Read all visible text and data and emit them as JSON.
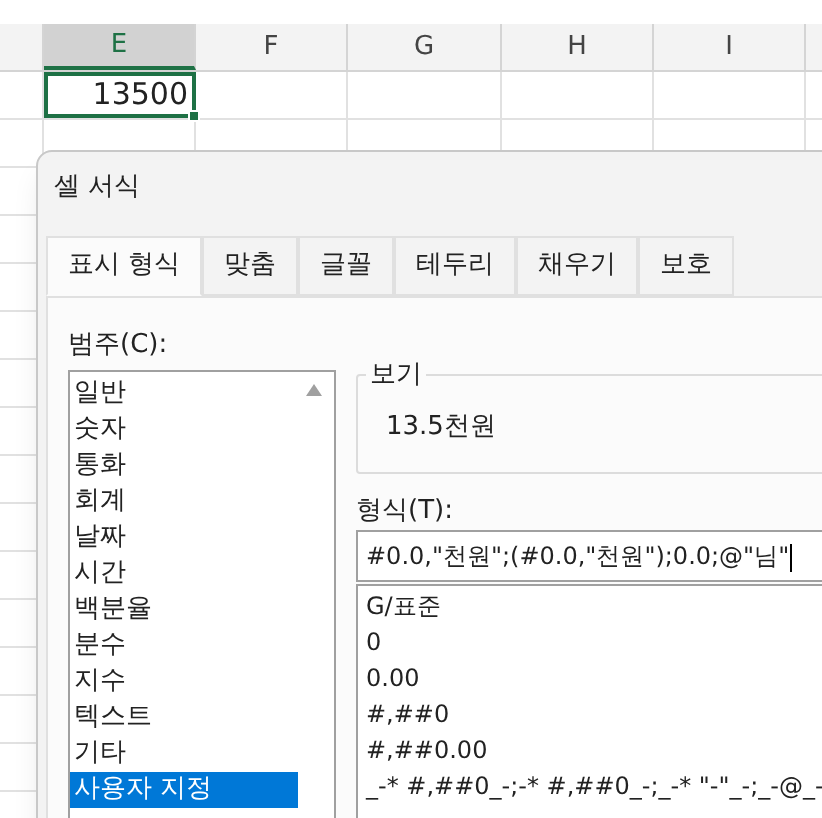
{
  "spreadsheet": {
    "columns": [
      {
        "label": "E",
        "selected": true
      },
      {
        "label": "F",
        "selected": false
      },
      {
        "label": "G",
        "selected": false
      },
      {
        "label": "H",
        "selected": false
      },
      {
        "label": "I",
        "selected": false
      }
    ],
    "cell_value": "13500"
  },
  "dialog": {
    "title": "셀 서식",
    "tabs": [
      {
        "label": "표시 형식",
        "selected": true
      },
      {
        "label": "맞춤",
        "selected": false
      },
      {
        "label": "글꼴",
        "selected": false
      },
      {
        "label": "테두리",
        "selected": false
      },
      {
        "label": "채우기",
        "selected": false
      },
      {
        "label": "보호",
        "selected": false
      }
    ],
    "category_label": "범주(C):",
    "categories": [
      {
        "label": "일반",
        "selected": false
      },
      {
        "label": "숫자",
        "selected": false
      },
      {
        "label": "통화",
        "selected": false
      },
      {
        "label": "회계",
        "selected": false
      },
      {
        "label": "날짜",
        "selected": false
      },
      {
        "label": "시간",
        "selected": false
      },
      {
        "label": "백분율",
        "selected": false
      },
      {
        "label": "분수",
        "selected": false
      },
      {
        "label": "지수",
        "selected": false
      },
      {
        "label": "텍스트",
        "selected": false
      },
      {
        "label": "기타",
        "selected": false
      },
      {
        "label": "사용자 지정",
        "selected": true
      }
    ],
    "preview": {
      "legend": "보기",
      "value": "13.5천원"
    },
    "format_label": "형식(T):",
    "format_value": "#0.0,\"천원\";(#0.0,\"천원\");0.0;@\"님\"",
    "formats": [
      "G/표준",
      "0",
      "0.00",
      "#,##0",
      "#,##0.00",
      "_-* #,##0_-;-* #,##0_-;_-* \"-\"_-;_-@_-"
    ]
  }
}
